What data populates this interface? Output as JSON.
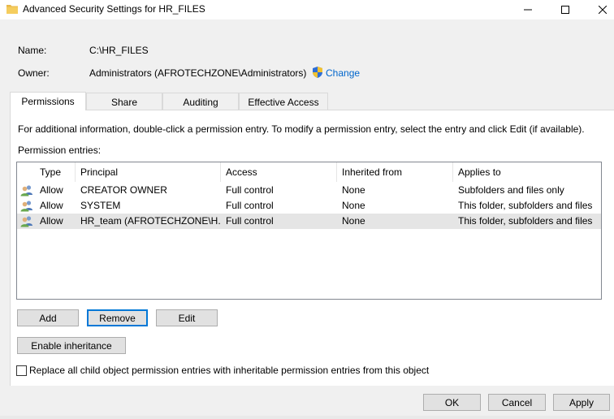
{
  "window": {
    "title": "Advanced Security Settings for HR_FILES",
    "icon": "folder-icon",
    "controls": [
      "minimize",
      "maximize",
      "close"
    ]
  },
  "object": {
    "name_label": "Name:",
    "name_value": "C:\\HR_FILES",
    "owner_label": "Owner:",
    "owner_value": "Administrators (AFROTECHZONE\\Administrators)",
    "change_link": "Change"
  },
  "tabs": [
    {
      "label": "Permissions",
      "active": true
    },
    {
      "label": "Share",
      "active": false
    },
    {
      "label": "Auditing",
      "active": false
    },
    {
      "label": "Effective Access",
      "active": false
    }
  ],
  "permissions": {
    "info_text": "For additional information, double-click a permission entry. To modify a permission entry, select the entry and click Edit (if available).",
    "entries_label": "Permission entries:",
    "columns": [
      "Type",
      "Principal",
      "Access",
      "Inherited from",
      "Applies to"
    ],
    "rows": [
      {
        "type": "Allow",
        "principal": "CREATOR OWNER",
        "access": "Full control",
        "inherited_from": "None",
        "applies_to": "Subfolders and files only",
        "selected": false
      },
      {
        "type": "Allow",
        "principal": "SYSTEM",
        "access": "Full control",
        "inherited_from": "None",
        "applies_to": "This folder, subfolders and files",
        "selected": false
      },
      {
        "type": "Allow",
        "principal": "HR_team (AFROTECHZONE\\H...",
        "access": "Full control",
        "inherited_from": "None",
        "applies_to": "This folder, subfolders and files",
        "selected": true
      }
    ],
    "add_button": "Add",
    "remove_button": "Remove",
    "edit_button": "Edit",
    "enable_inheritance_button": "Enable inheritance",
    "replace_checkbox_label": "Replace all child object permission entries with inheritable permission entries from this object",
    "replace_checked": false
  },
  "footer": {
    "ok": "OK",
    "cancel": "Cancel",
    "apply": "Apply"
  },
  "colors": {
    "link": "#0066cc",
    "selected_row": "#e5e5e5",
    "focus_border": "#0078d7"
  }
}
